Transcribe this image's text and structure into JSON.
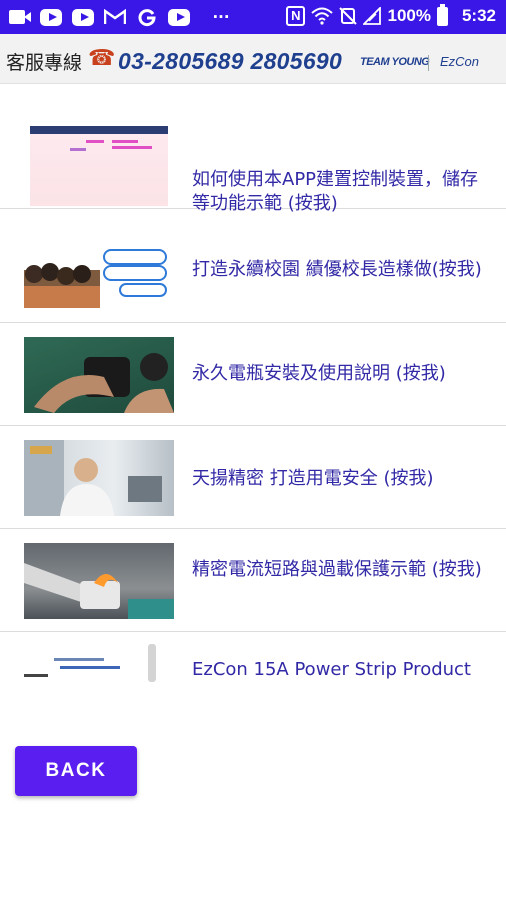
{
  "status_bar": {
    "battery": "100%",
    "time": "5:32",
    "icons": [
      "video-icon",
      "youtube-icon",
      "youtube-icon",
      "gmail-icon",
      "google-icon",
      "youtube-icon",
      "more-icon",
      "nfc-icon",
      "wifi-icon",
      "silent-icon",
      "signal-icon",
      "battery-icon"
    ],
    "overflow": "···",
    "nfc": "N"
  },
  "header": {
    "hotline_label": "客服專線",
    "phone_icon": "☎",
    "phone_numbers": "03-2805689 2805690",
    "logo_teamyoung": "TEAM YOUNG",
    "logo_ezcon": "EzCon"
  },
  "videos": [
    {
      "title": "如何使用本APP建置控制裝置，儲存等功能示範 (按我)"
    },
    {
      "title": "打造永續校園 績優校長造樣做(按我)"
    },
    {
      "title": "永久電瓶安裝及使用說明 (按我)"
    },
    {
      "title": "天揚精密 打造用電安全 (按我)"
    },
    {
      "title": "精密電流短路與過載保護示範 (按我)"
    },
    {
      "title": "EzCon 15A Power Strip Product"
    }
  ],
  "back_button": {
    "label": "BACK"
  },
  "colors": {
    "status_bar": "#3a17e6",
    "accent": "#5a1ff0",
    "link_text": "#3229a6",
    "brand_blue": "#1f3f8f"
  }
}
